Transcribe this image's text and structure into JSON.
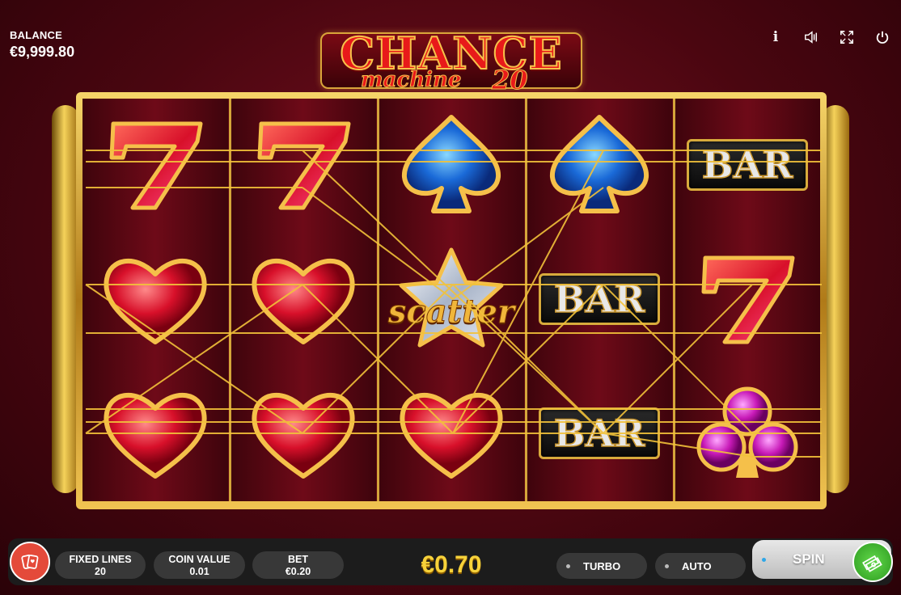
{
  "balance": {
    "label": "BALANCE",
    "value": "€9,999.80"
  },
  "logo": {
    "title": "CHANCE",
    "subtitle": "machine",
    "number": "20"
  },
  "top_icons": [
    "info-icon",
    "sound-icon",
    "fullscreen-icon",
    "power-icon"
  ],
  "info_glyph": "i",
  "reels": [
    [
      "seven",
      "heart",
      "heart"
    ],
    [
      "seven",
      "heart",
      "heart"
    ],
    [
      "spade",
      "scatter",
      "heart"
    ],
    [
      "spade",
      "bar",
      "bar"
    ],
    [
      "bar",
      "seven",
      "club"
    ]
  ],
  "symbols": {
    "bar_text": "BAR",
    "scatter_text": "scatter"
  },
  "controls": {
    "fixed_lines": {
      "label": "FIXED LINES",
      "value": "20"
    },
    "coin_value": {
      "label": "COIN VALUE",
      "value": "0.01"
    },
    "bet": {
      "label": "BET",
      "value": "€0.20"
    },
    "win": "€0.70",
    "turbo": "TURBO",
    "auto": "AUTO",
    "spin": "SPIN"
  },
  "colors": {
    "gold": "#d4a53a",
    "win": "#f7d23a",
    "spin_green": "#3aa82a",
    "cards_red": "#e44a3a"
  }
}
